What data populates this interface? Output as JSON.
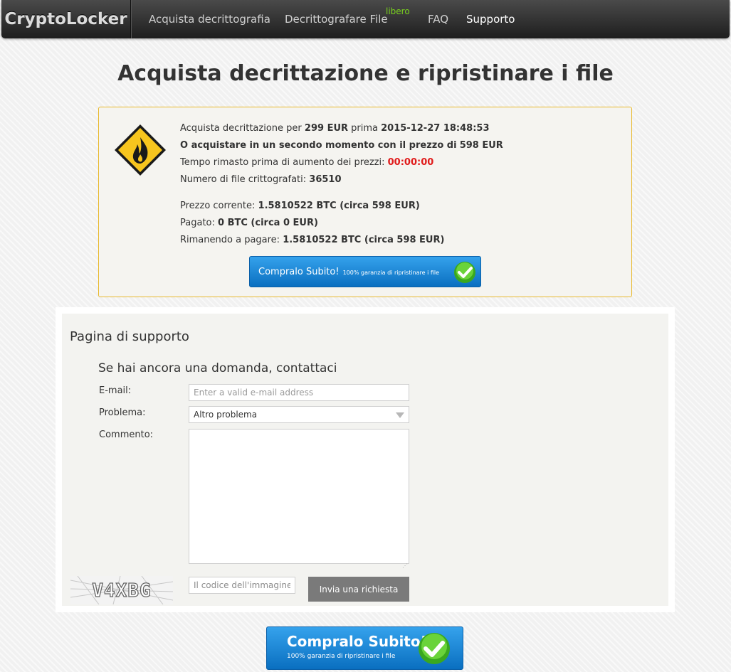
{
  "navbar": {
    "brand": "CryptoLocker",
    "items": [
      {
        "label": "Acquista decrittografia"
      },
      {
        "label": "Decrittografare File",
        "badge": "libero"
      },
      {
        "label": "FAQ"
      },
      {
        "label": "Supporto",
        "active": true
      }
    ]
  },
  "page_title": "Acquista decrittazione e ripristinare i file",
  "info": {
    "line1_prefix": "Acquista decrittazione per",
    "line1_price": "299 EUR",
    "line1_mid": "prima",
    "line1_date": "2015-12-27 18:48:53",
    "line2_prefix": "O acquistare in un secondo momento con il prezzo di",
    "line2_price": "598 EUR",
    "line3_prefix": "Tempo rimasto prima di aumento dei prezzi:",
    "line3_timer": "00:00:00",
    "line4_prefix": "Numero di file crittografati:",
    "line4_count": "36510",
    "line5_prefix": "Prezzo corrente:",
    "line5_value": "1.5810522 BTC (circa 598 EUR)",
    "line6_prefix": "Pagato:",
    "line6_value": "0 BTC (circa 0 EUR)",
    "line7_prefix": "Rimanendo a pagare:",
    "line7_value": "1.5810522 BTC (circa 598 EUR)",
    "buy_button": {
      "label": "Compralo Subito!",
      "sub": "100% garanzia di ripristinare i file"
    }
  },
  "support": {
    "title": "Pagina di supporto",
    "subtitle": "Se hai ancora una domanda, contattaci",
    "email_label": "E-mail:",
    "email_placeholder": "Enter a valid e-mail address",
    "email_value": "",
    "problem_label": "Problema:",
    "problem_value": "Altro problema",
    "comment_label": "Commento:",
    "comment_value": "",
    "captcha_text": "V4XBG",
    "captcha_placeholder": "Il codice dell'immagine",
    "send_label": "Invia una richiesta"
  },
  "big_buy_button": {
    "label": "Compralo Subito!",
    "sub": "100% garanzia di ripristinare i file"
  },
  "colors": {
    "accent_blue": "#0a6fc0",
    "warning_yellow": "#f7c51e",
    "timer_red": "#e01b1b",
    "badge_green": "#7ad31d"
  }
}
